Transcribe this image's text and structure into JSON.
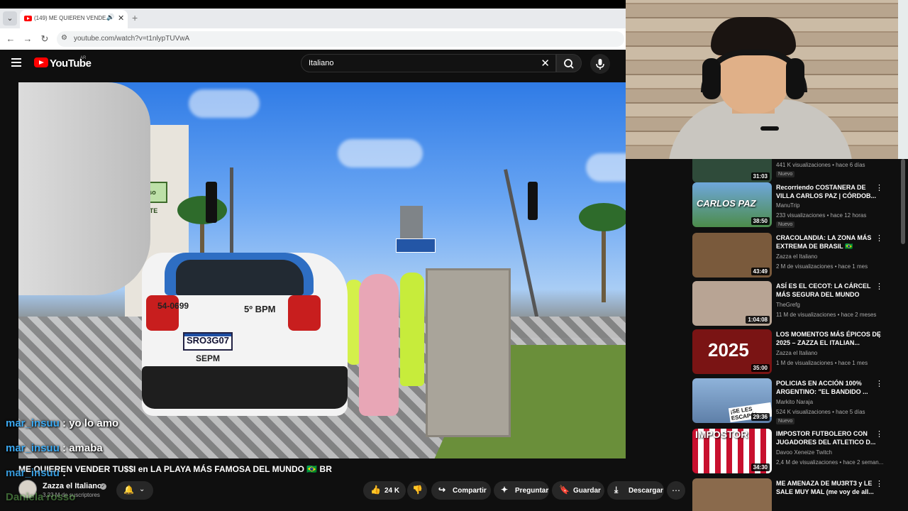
{
  "browser": {
    "tab_title": "(149) ME QUIEREN VENDE...",
    "tab_audio_icon": "speaker-icon",
    "new_tab": "+",
    "url": "youtube.com/watch?v=t1nlypTUVwA"
  },
  "header": {
    "logo_text": "YouTube",
    "country": "AR",
    "search_query": "Italiano"
  },
  "video_scene": {
    "shop_sign": "Rosso MONTE",
    "car_id": "54-0699",
    "car_unit": "5º BPM",
    "plate": "SRO3G07",
    "plate_sub": "SEPM"
  },
  "chat": [
    {
      "user": "mar_insuu",
      "msg": ": yo lo amo"
    },
    {
      "user": "mar_insuu",
      "msg": ": amaba"
    },
    {
      "user": "mar_insuu",
      "msg": ":"
    },
    {
      "user": "Daniela rosso",
      "msg": ""
    }
  ],
  "video": {
    "title": "ME QUIEREN VENDER TU$$I en LA PLAYA MÁS FAMOSA DEL MUNDO 🇧🇷 BR",
    "channel": "Zazza el Italiano",
    "subscribers": "3,23 M de suscriptores",
    "likes": "24 K",
    "share_label": "Compartir",
    "ask_label": "Preguntar",
    "save_label": "Guardar",
    "download_label": "Descargar"
  },
  "sidebar": [
    {
      "title": "",
      "channel": "",
      "meta": "441 K visualizaciones • hace 6 días",
      "badge": "Nuevo",
      "duration": "31:03",
      "color": "#2f4b3a"
    },
    {
      "title": "Recorriendo COSTANERA DE VILLA CARLOS PAZ | CÓRDOB...",
      "channel": "ManuTrip",
      "meta": "233 visualizaciones • hace 12 horas",
      "badge": "Nuevo",
      "duration": "38:50",
      "color": "#4c8c4a",
      "thumb_text": "CARLOS PAZ"
    },
    {
      "title": "CRACOLANDIA: LA ZONA MÁS EXTREMA DE BRASIL 🇧🇷",
      "channel": "Zazza el Italiano",
      "meta": "2 M de visualizaciones • hace 1 mes",
      "badge": "",
      "duration": "43:49",
      "color": "#7a5a3c"
    },
    {
      "title": "ASÍ ES EL CECOT: LA CÁRCEL MÁS SEGURA DEL MUNDO",
      "channel": "TheGrefg",
      "meta": "11 M de visualizaciones • hace 2 meses",
      "badge": "",
      "duration": "1:04:08",
      "color": "#b8a494"
    },
    {
      "title": "LOS MOMENTOS MÁS ÉPICOS DE 2025 – ZAZZA EL ITALIAN...",
      "channel": "Zazza el Italiano",
      "meta": "1 M de visualizaciones • hace 1 mes",
      "badge": "",
      "duration": "35:00",
      "color": "#7a1414",
      "thumb_text": "2025"
    },
    {
      "title": "POLICIAS EN ACCIÓN 100% ARGENTINO: \"EL BANDIDO ...",
      "channel": "Markito Naraja",
      "meta": "524 K visualizaciones • hace 5 días",
      "badge": "Nuevo",
      "duration": "29:36",
      "color": "#5e7fa8",
      "thumb_text": "¡SE LES ESCAPÓ!"
    },
    {
      "title": "IMPOSTOR FUTBOLERO CON JUGADORES DEL ATLETICO D...",
      "channel": "Davoo Xeneize Twitch",
      "meta": "2,4 M de visualizaciones • hace 2 seman...",
      "badge": "",
      "duration": "34:30",
      "color": "#d9d9d9",
      "thumb_text": "IMPOSTOR"
    },
    {
      "title": "ME AMENAZA DE MU3RT3 y LE SALE MUY MAL (me voy de all...",
      "channel": "",
      "meta": "",
      "badge": "",
      "duration": "",
      "color": "#8a6a4c"
    }
  ]
}
